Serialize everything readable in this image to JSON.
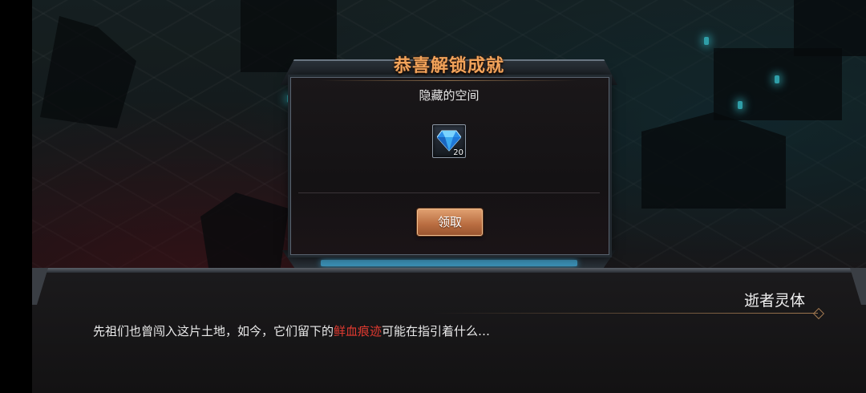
{
  "popup": {
    "title": "恭喜解锁成就",
    "achievement_name": "隐藏的空间",
    "reward": {
      "icon": "blue-diamond-icon",
      "count": "20"
    },
    "claim_label": "领取"
  },
  "dialog": {
    "speaker": "逝者灵体",
    "text_before": "先祖们也曾闯入这片土地，如今，它们留下的",
    "text_highlight": "鲜血痕迹",
    "text_after": "可能在指引着什么…",
    "highlight_color": "#e03a30"
  }
}
